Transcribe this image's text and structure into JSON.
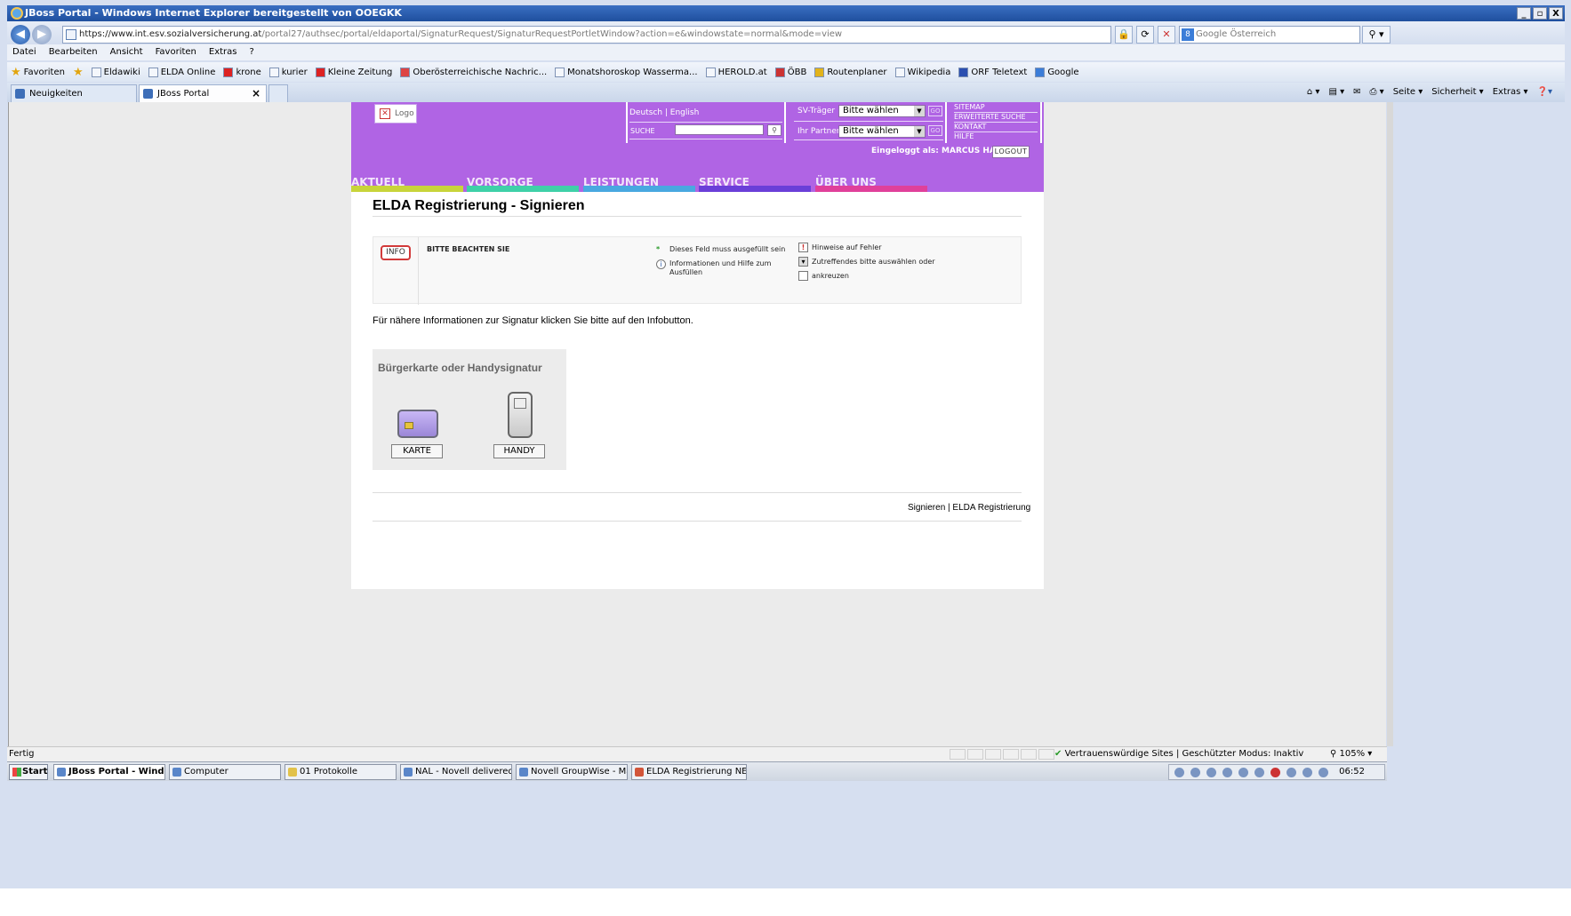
{
  "window": {
    "title": "JBoss Portal - Windows Internet Explorer bereitgestellt von OOEGKK",
    "controls": [
      "_",
      "▫",
      "X"
    ]
  },
  "address": {
    "url_main": "https://www.int.esv.sozialversicherung.at",
    "url_rest": "/portal27/authsec/portal/eldaportal/SignaturRequest/SignaturRequestPortletWindow?action=e&windowstate=normal&mode=view",
    "search_placeholder": "Google Österreich"
  },
  "menu": [
    "Datei",
    "Bearbeiten",
    "Ansicht",
    "Favoriten",
    "Extras",
    "?"
  ],
  "favorites": {
    "label": "Favoriten",
    "items": [
      "Eldawiki",
      "ELDA Online",
      "krone",
      "kurier",
      "Kleine Zeitung",
      "Oberösterreichische Nachric...",
      "Monatshoroskop Wasserma...",
      "HEROLD.at",
      "ÖBB",
      "Routenplaner",
      "Wikipedia",
      "ORF Teletext",
      "Google"
    ]
  },
  "tabs": {
    "tab1": "Neuigkeiten",
    "tab2": "JBoss Portal",
    "commands": [
      "Seite ▾",
      "Sicherheit ▾",
      "Extras ▾"
    ]
  },
  "portal": {
    "logo": "Logo",
    "languages": "Deutsch | English",
    "search_label": "SUCHE",
    "sv_label": "SV-Träger",
    "sv_value": "Bitte wählen",
    "partner_label": "Ihr Partner",
    "partner_value": "Bitte wählen",
    "go": "GO",
    "links": [
      "SITEMAP",
      "ERWEITERTE SUCHE",
      "KONTAKT",
      "HILFE"
    ],
    "logged_in": "Eingeloggt als: MARCUS HAHN",
    "logout": "LOGOUT",
    "nav": [
      "AKTUELL",
      "VORSORGE",
      "LEISTUNGEN",
      "SERVICE",
      "ÜBER UNS"
    ],
    "nav_colors": [
      "#c8d43a",
      "#3fd0a8",
      "#49a8e0",
      "#6a3fd8",
      "#e0409a"
    ]
  },
  "main": {
    "title": "ELDA Registrierung - Signieren",
    "info_button": "INFO",
    "info_heading": "BITTE BEACHTEN SIE",
    "legend_required": "Dieses Feld muss ausgefüllt sein",
    "legend_info": "Informationen und Hilfe zum Ausfüllen",
    "legend_errors": "Hinweise auf Fehler",
    "legend_select": "Zutreffendes bitte auswählen oder",
    "legend_check": "ankreuzen",
    "hint": "Für nähere Informationen zur Signatur klicken Sie bitte auf den Infobutton.",
    "sig_title": "Bürgerkarte oder Handysignatur",
    "card_button": "KARTE",
    "handy_button": "HANDY",
    "breadcrumb": "Signieren | ELDA Registrierung"
  },
  "status": {
    "text": "Fertig",
    "zone": "Vertrauenswürdige Sites | Geschützter Modus: Inaktiv",
    "zoom": "105%"
  },
  "taskbar": {
    "start": "Start",
    "tasks": [
      "JBoss Portal - Windo...",
      "Computer",
      "01 Protokolle",
      "NAL - Novell delivered A...",
      "Novell GroupWise - Mailbox",
      "ELDA Registrierung NEU...."
    ],
    "clock": "06:52"
  }
}
